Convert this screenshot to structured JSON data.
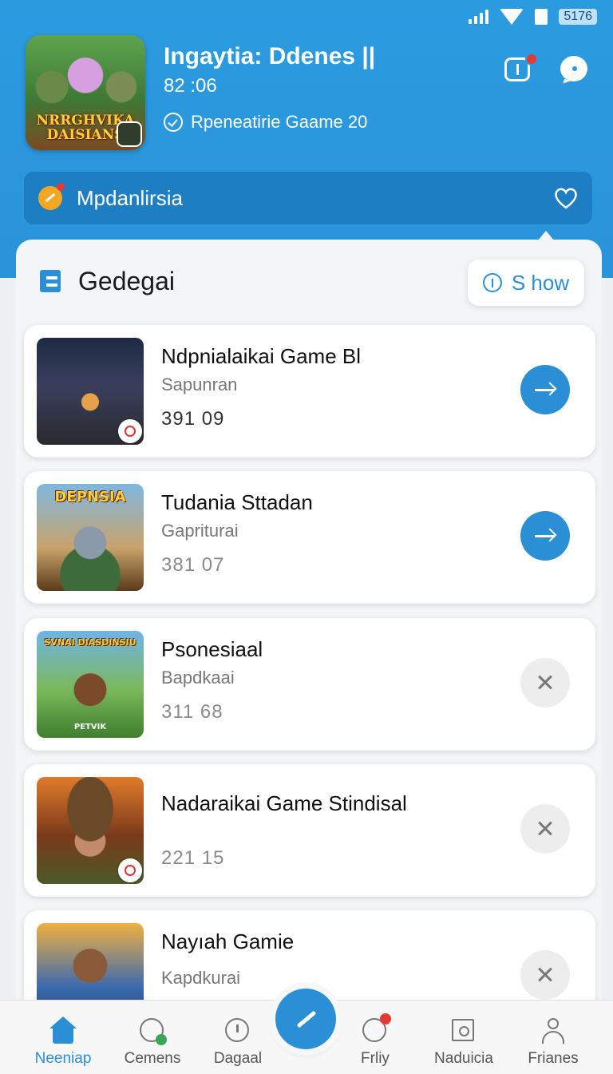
{
  "status_bar": {
    "battery_text": "5176"
  },
  "header": {
    "game_art_title": "NRRGHVIKA DAISIANS",
    "title": "Ingaytia: Ddenes ||",
    "time": "82 :06",
    "subtitle": "Rpeneatirie Gaame 20"
  },
  "subscription": {
    "label": "Mpdanlirsia"
  },
  "section": {
    "title": "Gedegai",
    "show_label": "S how"
  },
  "cards": [
    {
      "title": "Ndpnialaikai Game Bl",
      "subtitle": "Sapunran",
      "stat": "391  09",
      "action": "arrow"
    },
    {
      "title": "Tudania Sttadan",
      "subtitle": "Gapriturai",
      "stat": "381  07",
      "action": "arrow",
      "thumb_text": "DEPNSIA"
    },
    {
      "title": "Psonesiaal",
      "subtitle": "Bapdkaai",
      "stat": "311  68",
      "action": "close",
      "thumb_text": "SVNAI DIASDINSIU",
      "thumb_caption": "PETVIK"
    },
    {
      "title": "Nadaraikai Game Stindisal",
      "subtitle": "",
      "stat": "221  15",
      "action": "close"
    },
    {
      "title": "Nayıah Gamie",
      "subtitle": "Kapdkurai",
      "stat": "",
      "action": "close"
    }
  ],
  "bottom_nav": [
    {
      "label": "Neeniap"
    },
    {
      "label": "Cemens"
    },
    {
      "label": "Dagaal"
    },
    {
      "label": "Frliy"
    },
    {
      "label": "Naduicia"
    },
    {
      "label": "Frianes"
    }
  ],
  "colors": {
    "primary": "#2b8fd6",
    "header_bg": "#2b9be0",
    "subscription_bg": "#1e7ec4",
    "notification": "#e53935"
  }
}
